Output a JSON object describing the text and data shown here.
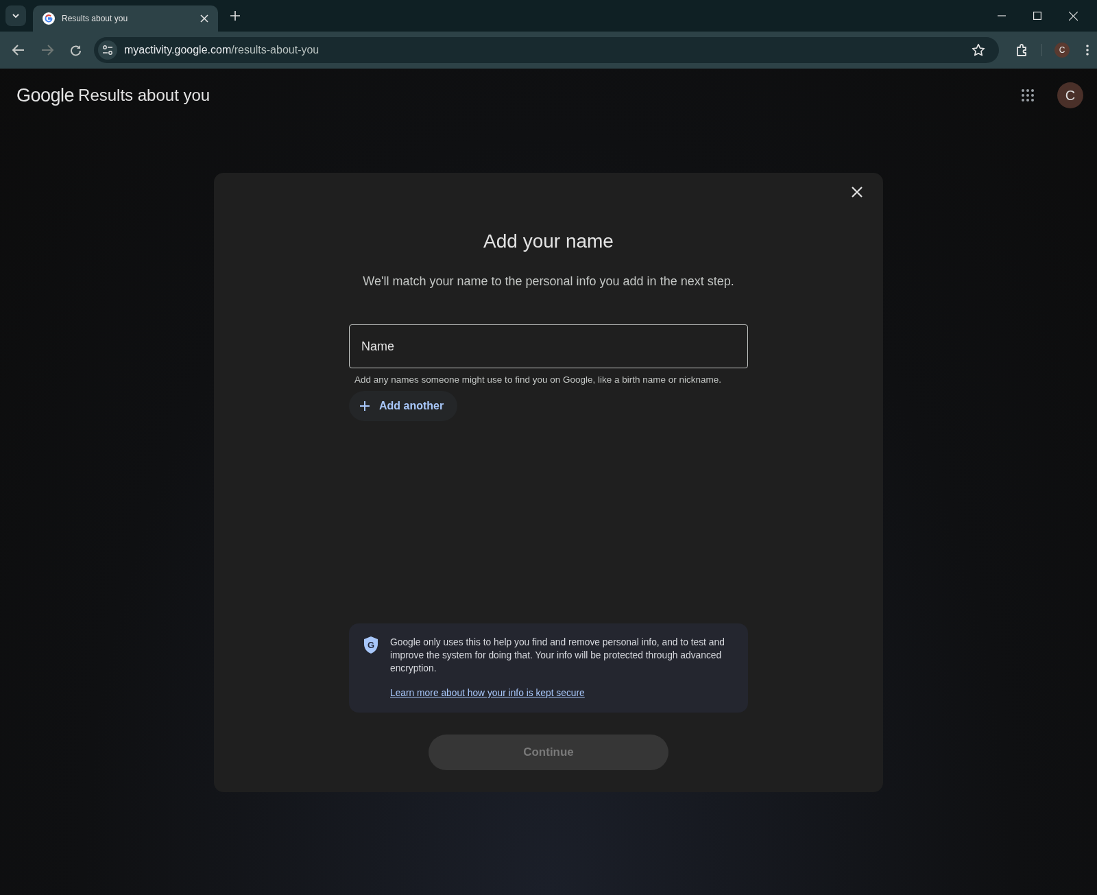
{
  "browser": {
    "tab": {
      "title": "Results about you",
      "selected": true
    },
    "address": {
      "host": "myactivity.google.com",
      "path": "/results-about-you"
    },
    "profile_initial": "C",
    "bookmarked": false
  },
  "header": {
    "logo": "Google",
    "title": "Results about you",
    "avatar_initial": "C"
  },
  "dialog": {
    "title": "Add your name",
    "subtitle": "We'll match your name to the personal info you add in the next step.",
    "name_field": {
      "placeholder": "Name",
      "helper": "Add any names someone might use to find you on Google, like a birth name or nickname."
    },
    "add_button": {
      "label": "Add another"
    },
    "notice": {
      "shield_letter": "G",
      "text": "Google only uses this to help you find and remove personal info, and to test and improve the system for doing that. Your info will be protected through advanced encryption.",
      "link": "Learn more about how your info is kept secure"
    },
    "continue_button": {
      "label": "Continue",
      "disabled": true
    }
  }
}
